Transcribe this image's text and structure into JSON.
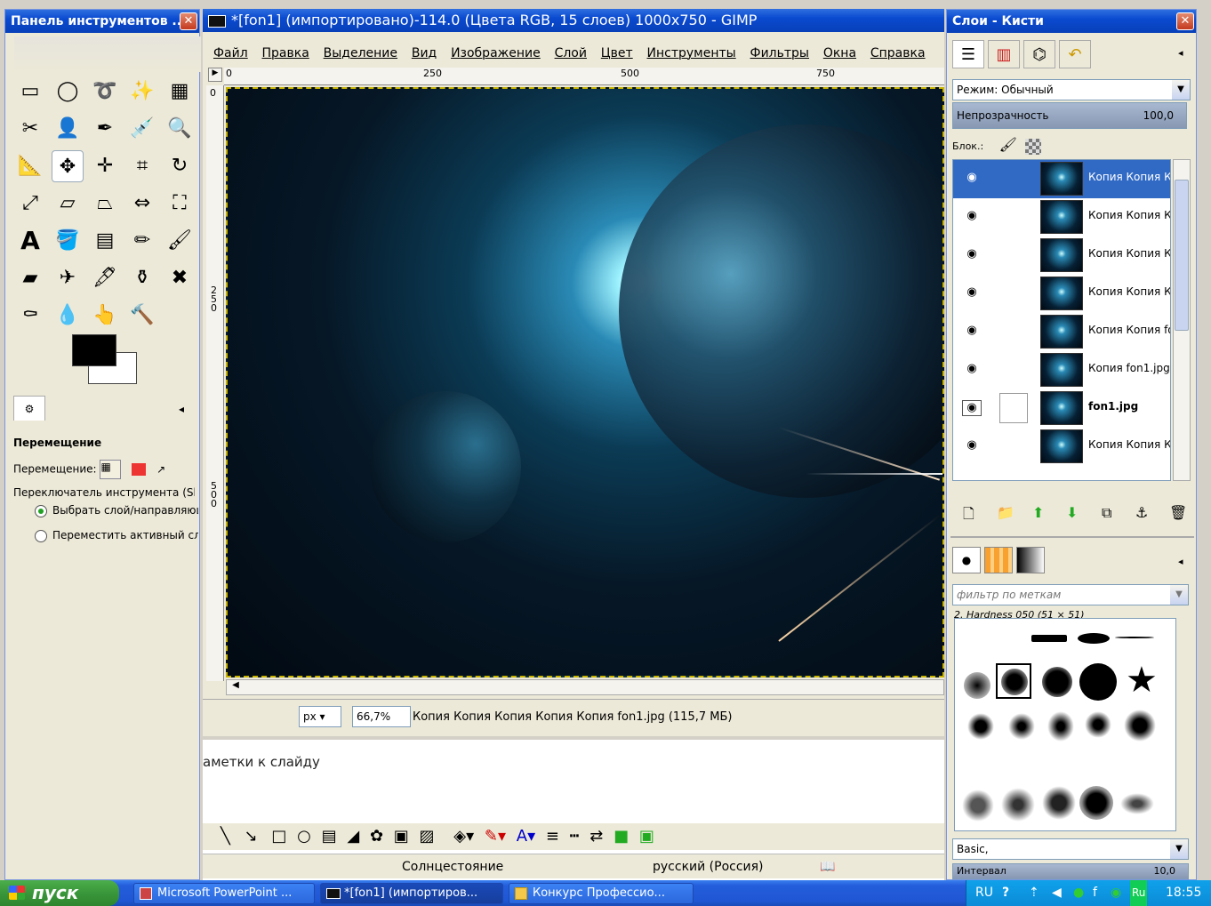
{
  "toolbox": {
    "title": "Панель инструментов ...",
    "tool_options_title": "Перемещение",
    "move_label": "Перемещение:",
    "switch_label": "Переключатель инструмента (Shi",
    "radio1": "Выбрать слой/направляющу",
    "radio2": "Переместить активный сло"
  },
  "image_window": {
    "title": "*[fon1] (импортировано)-114.0 (Цвета RGB, 15 слоев) 1000x750 - GIMP",
    "menus": [
      "Файл",
      "Правка",
      "Выделение",
      "Вид",
      "Изображение",
      "Слой",
      "Цвет",
      "Инструменты",
      "Фильтры",
      "Окна",
      "Справка"
    ],
    "ruler_h": [
      "0",
      "250",
      "500",
      "750"
    ],
    "ruler_v": [
      "0",
      "250",
      "500"
    ],
    "unit": "px",
    "zoom": "66,7%",
    "status_text": "Копия Копия Копия Копия Копия fon1.jpg (115,7 МБ)"
  },
  "powerpoint": {
    "notes": "аметки к слайду",
    "theme": "Солнцестояние",
    "language": "русский (Россия)"
  },
  "dock": {
    "title": "Слои - Кисти",
    "mode_label": "Режим:",
    "mode_value": "Обычный",
    "opacity_label": "Непрозрачность",
    "opacity_value": "100,0",
    "lock_label": "Блок.:",
    "layers": [
      "Копия Копия Ко",
      "Копия Копия Ко",
      "Копия Копия Ко",
      "Копия Копия Ко",
      "Копия Копия fo",
      "Копия fon1.jpg",
      "fon1.jpg",
      "Копия Копия Ко"
    ],
    "tag_filter_placeholder": "фильтр по меткам",
    "brush_name": "2. Hardness 050 (51 × 51)",
    "brush_set": "Basic,",
    "spacing_label": "Интервал",
    "spacing_value": "10,0"
  },
  "taskbar": {
    "start": "пуск",
    "tasks": [
      "Microsoft PowerPoint ...",
      "*[fon1] (импортиров...",
      "Конкурс Профессио..."
    ],
    "lang": "RU",
    "time": "18:55"
  }
}
